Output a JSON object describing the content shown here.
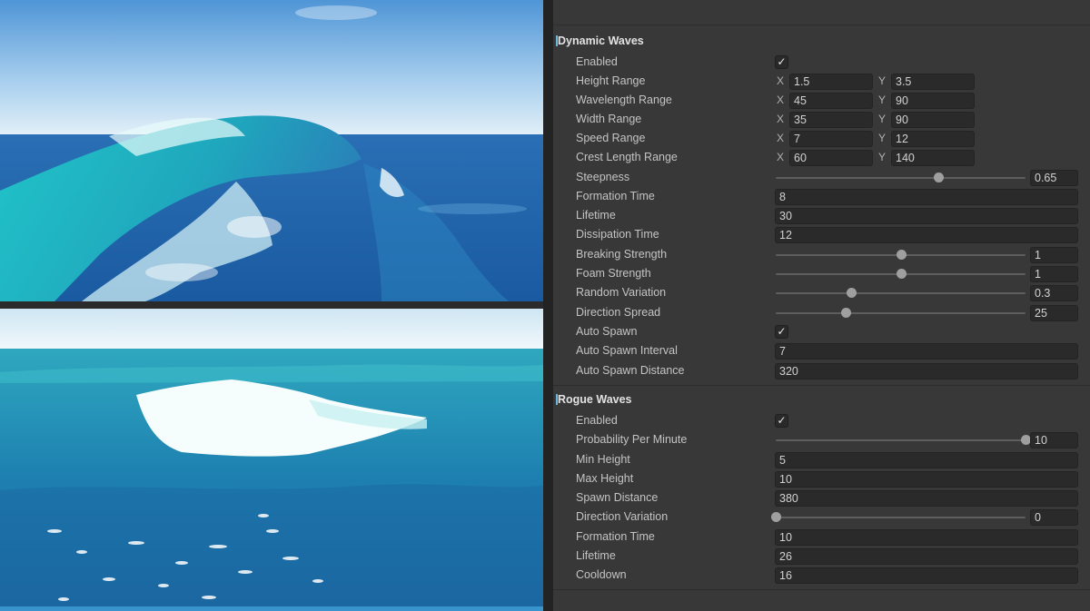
{
  "dynamic_waves": {
    "title": "Dynamic Waves",
    "enabled": {
      "label": "Enabled",
      "checked": true
    },
    "height_range": {
      "label": "Height Range",
      "x_label": "X",
      "x": "1.5",
      "y_label": "Y",
      "y": "3.5"
    },
    "wavelength_range": {
      "label": "Wavelength Range",
      "x_label": "X",
      "x": "45",
      "y_label": "Y",
      "y": "90"
    },
    "width_range": {
      "label": "Width Range",
      "x_label": "X",
      "x": "35",
      "y_label": "Y",
      "y": "90"
    },
    "speed_range": {
      "label": "Speed Range",
      "x_label": "X",
      "x": "7",
      "y_label": "Y",
      "y": "12"
    },
    "crest_length_range": {
      "label": "Crest Length Range",
      "x_label": "X",
      "x": "60",
      "y_label": "Y",
      "y": "140"
    },
    "steepness": {
      "label": "Steepness",
      "value": "0.65",
      "fraction": 0.65
    },
    "formation_time": {
      "label": "Formation Time",
      "value": "8"
    },
    "lifetime": {
      "label": "Lifetime",
      "value": "30"
    },
    "dissipation_time": {
      "label": "Dissipation Time",
      "value": "12"
    },
    "breaking_strength": {
      "label": "Breaking Strength",
      "value": "1",
      "fraction": 0.5
    },
    "foam_strength": {
      "label": "Foam Strength",
      "value": "1",
      "fraction": 0.5
    },
    "random_variation": {
      "label": "Random Variation",
      "value": "0.3",
      "fraction": 0.3
    },
    "direction_spread": {
      "label": "Direction Spread",
      "value": "25",
      "fraction": 0.28
    },
    "auto_spawn": {
      "label": "Auto Spawn",
      "checked": true
    },
    "auto_spawn_interval": {
      "label": "Auto Spawn Interval",
      "value": "7"
    },
    "auto_spawn_distance": {
      "label": "Auto Spawn Distance",
      "value": "320"
    }
  },
  "rogue_waves": {
    "title": "Rogue Waves",
    "enabled": {
      "label": "Enabled",
      "checked": true
    },
    "probability_per_minute": {
      "label": "Probability Per Minute",
      "value": "10",
      "fraction": 1.0
    },
    "min_height": {
      "label": "Min Height",
      "value": "5"
    },
    "max_height": {
      "label": "Max Height",
      "value": "10"
    },
    "spawn_distance": {
      "label": "Spawn Distance",
      "value": "380"
    },
    "direction_variation": {
      "label": "Direction Variation",
      "value": "0",
      "fraction": 0.0
    },
    "formation_time": {
      "label": "Formation Time",
      "value": "10"
    },
    "lifetime": {
      "label": "Lifetime",
      "value": "26"
    },
    "cooldown": {
      "label": "Cooldown",
      "value": "16"
    }
  },
  "colors": {
    "panel_bg": "#383838",
    "field_bg": "#2a2a2a",
    "accent": "#6bb7d6",
    "ocean_deep": "#1e6ea8",
    "ocean_cyan": "#2fb7c4"
  }
}
